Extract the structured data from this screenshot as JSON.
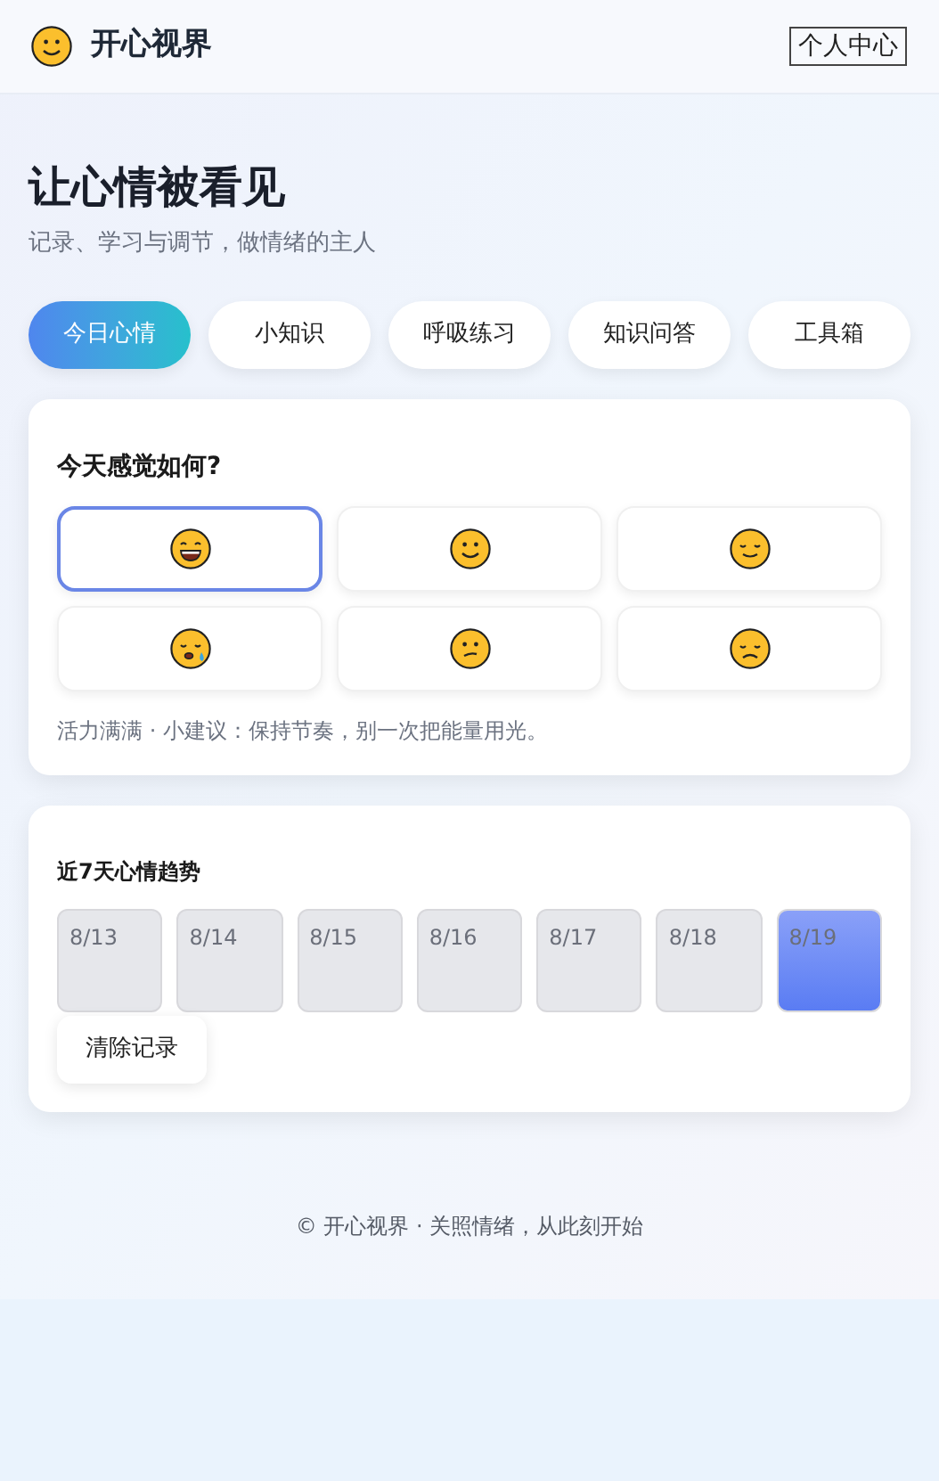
{
  "header": {
    "brand": "开心视界",
    "profile_button": "个人中心"
  },
  "hero": {
    "title": "让心情被看见",
    "subtitle": "记录、学习与调节，做情绪的主人"
  },
  "tabs": [
    {
      "label": "今日心情",
      "selected": true
    },
    {
      "label": "小知识",
      "selected": false
    },
    {
      "label": "呼吸练习",
      "selected": false
    },
    {
      "label": "知识问答",
      "selected": false
    },
    {
      "label": "工具箱",
      "selected": false
    }
  ],
  "mood_card": {
    "title": "今天感觉如何?",
    "moods": [
      {
        "kind": "grin",
        "selected": true
      },
      {
        "kind": "smile",
        "selected": false
      },
      {
        "kind": "relieved",
        "selected": false
      },
      {
        "kind": "sleepy",
        "selected": false
      },
      {
        "kind": "confused",
        "selected": false
      },
      {
        "kind": "sad",
        "selected": false
      }
    ],
    "tip": "活力满满 · 小建议：保持节奏，别一次把能量用光。"
  },
  "trend_card": {
    "title": "近7天心情趋势",
    "days": [
      {
        "label": "8/13",
        "recorded": false
      },
      {
        "label": "8/14",
        "recorded": false
      },
      {
        "label": "8/15",
        "recorded": false
      },
      {
        "label": "8/16",
        "recorded": false
      },
      {
        "label": "8/17",
        "recorded": false
      },
      {
        "label": "8/18",
        "recorded": false
      },
      {
        "label": "8/19",
        "recorded": true
      }
    ],
    "clear_button": "清除记录"
  },
  "footer": "© 开心视界 · 关照情绪，从此刻开始"
}
